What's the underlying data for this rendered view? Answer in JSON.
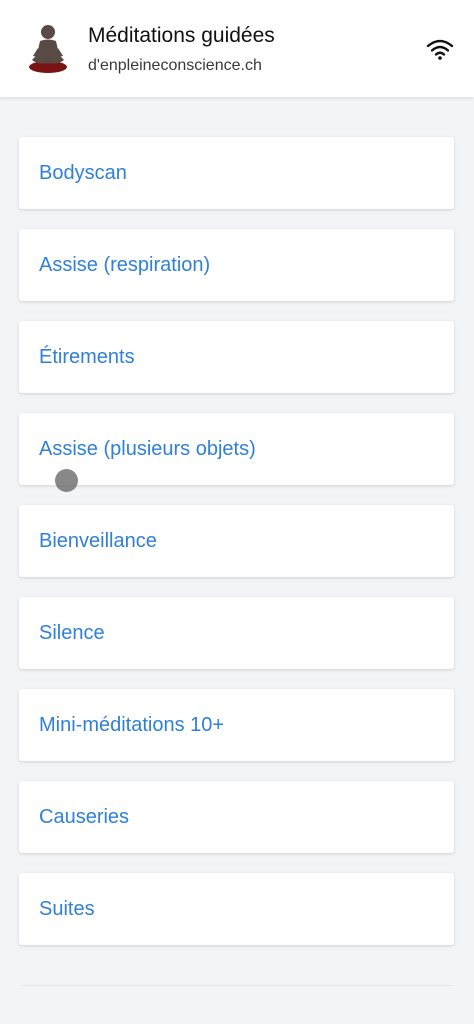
{
  "header": {
    "title": "Méditations guidées",
    "subtitle": "d'enpleineconscience.ch",
    "logo_icon": "meditating-person-icon",
    "status_icon": "wifi-icon"
  },
  "menu": {
    "items": [
      {
        "label": "Bodyscan"
      },
      {
        "label": "Assise (respiration)"
      },
      {
        "label": "Étirements"
      },
      {
        "label": "Assise (plusieurs objets)"
      },
      {
        "label": "Bienveillance"
      },
      {
        "label": "Silence"
      },
      {
        "label": "Mini-méditations 10+"
      },
      {
        "label": "Causeries"
      },
      {
        "label": "Suites"
      }
    ]
  },
  "colors": {
    "accent": "#2f80d9",
    "background": "#f3f4f6",
    "card": "#ffffff",
    "title_text": "#111111"
  }
}
